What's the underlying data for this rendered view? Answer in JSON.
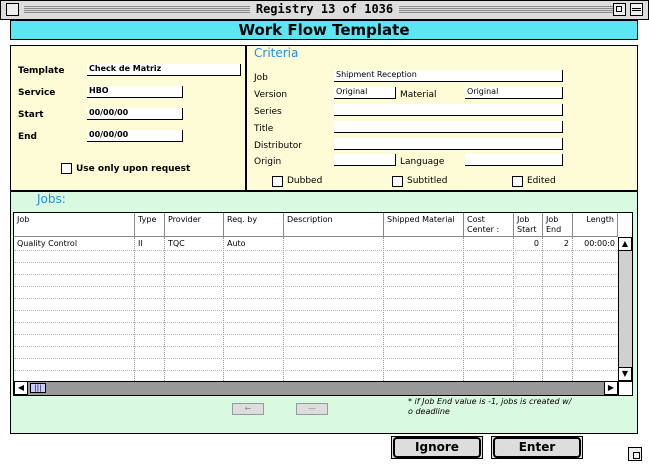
{
  "window": {
    "title": "Registry 13 of 1036"
  },
  "header": {
    "title": "Work Flow Template"
  },
  "left_panel": {
    "template": {
      "label": "Template",
      "value": "Check de Matriz"
    },
    "service": {
      "label": "Service",
      "value": "HBO"
    },
    "start": {
      "label": "Start",
      "value": "00/00/00"
    },
    "end": {
      "label": "End",
      "value": "00/00/00"
    },
    "request_checkbox": {
      "label": "Use only upon request",
      "checked": false
    }
  },
  "criteria": {
    "title": "Criteria",
    "job": {
      "label": "Job",
      "value": "Shipment Reception"
    },
    "version": {
      "label": "Version",
      "value": "Original"
    },
    "material": {
      "label": "Material",
      "value": "Original"
    },
    "series": {
      "label": "Series",
      "value": ""
    },
    "title_field": {
      "label": "Title",
      "value": ""
    },
    "distributor": {
      "label": "Distributor",
      "value": ""
    },
    "origin": {
      "label": "Origin",
      "value": ""
    },
    "language": {
      "label": "Language",
      "value": ""
    },
    "dubbed": {
      "label": "Dubbed",
      "checked": false
    },
    "subtitled": {
      "label": "Subtitled",
      "checked": false
    },
    "edited": {
      "label": "Edited",
      "checked": false
    }
  },
  "jobs": {
    "title": "Jobs:",
    "columns": [
      "Job",
      "Type",
      "Provider",
      "Req. by",
      "Description",
      "Shipped Material",
      "Cost Center :",
      "Job Start",
      "Job End",
      "Length"
    ],
    "rows": [
      {
        "job": "Quality Control",
        "type": "II",
        "provider": "TQC",
        "req_by": "Auto",
        "description": "",
        "shipped_material": "",
        "cost_center": "",
        "job_start": "0",
        "job_end": "2",
        "length": "00:00:0"
      }
    ],
    "note": "* if Job End value is -1, jobs is created w/ o deadline"
  },
  "buttons": {
    "ignore": "Ignore",
    "enter": "Enter"
  }
}
